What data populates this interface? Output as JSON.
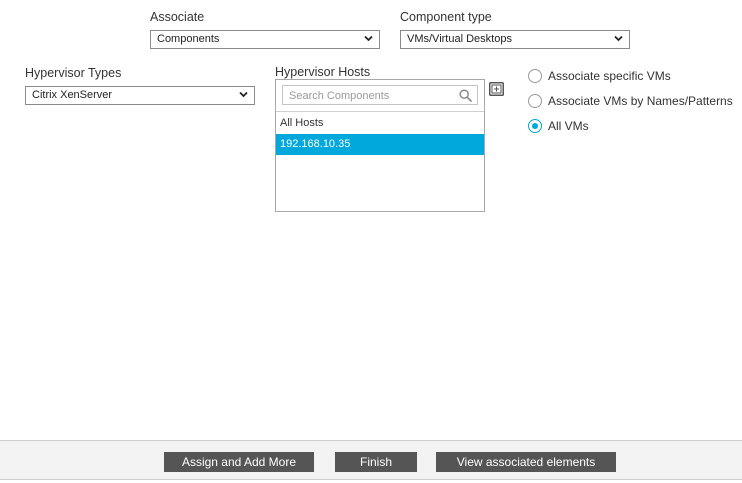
{
  "associate": {
    "label": "Associate",
    "value": "Components"
  },
  "component_type": {
    "label": "Component type",
    "value": "VMs/Virtual Desktops"
  },
  "hypervisor_types": {
    "label": "Hypervisor Types",
    "value": "Citrix XenServer"
  },
  "hypervisor_hosts": {
    "label": "Hypervisor Hosts",
    "search_placeholder": "Search Components",
    "items": [
      {
        "label": "All Hosts",
        "selected": false
      },
      {
        "label": "192.168.10.35",
        "selected": true
      }
    ]
  },
  "vm_options": {
    "options": [
      {
        "label": "Associate specific VMs",
        "checked": false
      },
      {
        "label": "Associate VMs by Names/Patterns",
        "checked": false
      },
      {
        "label": "All VMs",
        "checked": true
      }
    ]
  },
  "footer": {
    "assign_add_more_label": "Assign and Add More",
    "finish_label": "Finish",
    "view_associated_label": "View associated elements"
  },
  "colors": {
    "accent": "#00a8dc",
    "button_bg": "#555555",
    "footer_bg": "#f3f3f3"
  },
  "icons": {
    "dropdown": "chevron-down-icon",
    "search": "search-icon",
    "side_action": "expand-list-icon"
  }
}
